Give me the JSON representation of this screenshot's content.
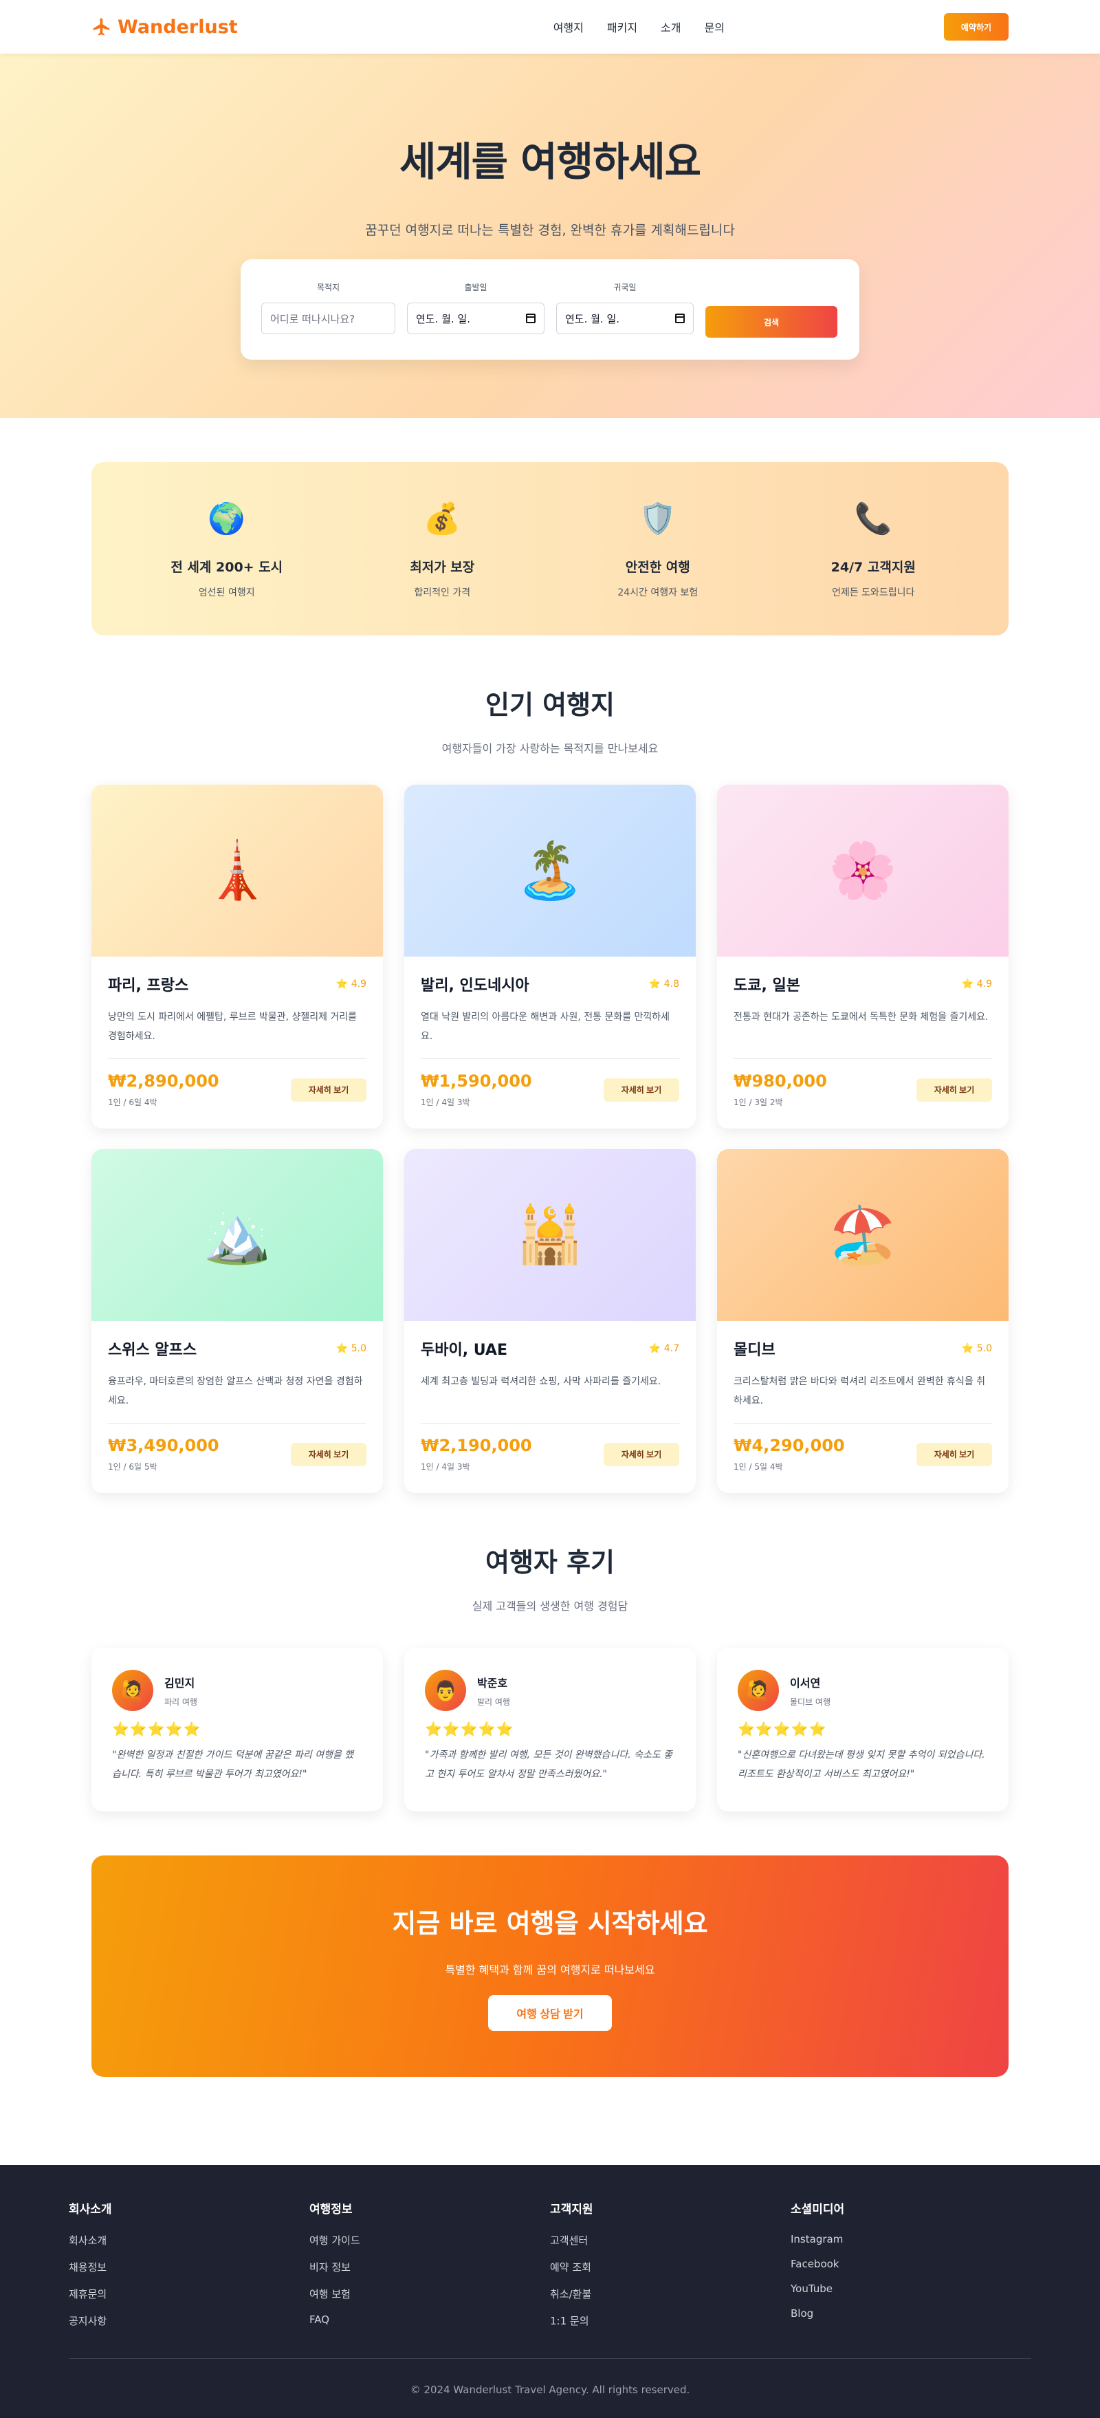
{
  "nav": {
    "logo": "Wanderlust",
    "menu": [
      "여행지",
      "패키지",
      "소개",
      "문의"
    ],
    "book_button": "예약하기"
  },
  "hero": {
    "title": "세계를 여행하세요",
    "subtitle": "꿈꾸던 여행지로 떠나는 특별한 경험, 완벽한 휴가를 계획해드립니다",
    "search": {
      "destination_label": "목적지",
      "destination_placeholder": "어디로 떠나시나요?",
      "departure_label": "출발일",
      "departure_value": "연도. 월. 일.",
      "return_label": "귀국일",
      "return_value": "연도. 월. 일.",
      "search_button": "검색"
    }
  },
  "features": [
    {
      "icon": "globe-icon",
      "glyph": "🌍",
      "title": "전 세계 200+ 도시",
      "desc": "엄선된 여행지"
    },
    {
      "icon": "money-bag-icon",
      "glyph": "💰",
      "title": "최저가 보장",
      "desc": "합리적인 가격"
    },
    {
      "icon": "shield-icon",
      "glyph": "🛡️",
      "title": "안전한 여행",
      "desc": "24시간 여행자 보험"
    },
    {
      "icon": "phone-icon",
      "glyph": "📞",
      "title": "24/7 고객지원",
      "desc": "언제든 도와드립니다"
    }
  ],
  "destinations_section": {
    "title": "인기 여행지",
    "subtitle": "여행자들이 가장 사랑하는 목적지를 만나보세요",
    "detail_label": "자세히 보기"
  },
  "destinations": [
    {
      "name": "파리, 프랑스",
      "rating": "⭐ 4.9",
      "desc": "낭만의 도시 파리에서 에펠탑, 루브르 박물관, 샹젤리제 거리를 경험하세요.",
      "price": "₩2,890,000",
      "duration": "1인 / 6일 4박",
      "glyph": "🗼",
      "icon": "tower-icon",
      "bg": "linear-gradient(135deg,#fef3c7,#fed7aa)"
    },
    {
      "name": "발리, 인도네시아",
      "rating": "⭐ 4.8",
      "desc": "열대 낙원 발리의 아름다운 해변과 사원, 전통 문화를 만끽하세요.",
      "price": "₩1,590,000",
      "duration": "1인 / 4일 3박",
      "glyph": "🏝️",
      "icon": "island-icon",
      "bg": "linear-gradient(135deg,#dbeafe,#bfdbfe)"
    },
    {
      "name": "도쿄, 일본",
      "rating": "⭐ 4.9",
      "desc": "전통과 현대가 공존하는 도쿄에서 독특한 문화 체험을 즐기세요.",
      "price": "₩980,000",
      "duration": "1인 / 3일 2박",
      "glyph": "🌸",
      "icon": "cherry-blossom-icon",
      "bg": "linear-gradient(135deg,#fce7f3,#fbcfe8)"
    },
    {
      "name": "스위스 알프스",
      "rating": "⭐ 5.0",
      "desc": "융프라우, 마터호른의 장엄한 알프스 산맥과 청정 자연을 경험하세요.",
      "price": "₩3,490,000",
      "duration": "1인 / 6일 5박",
      "glyph": "🏔️",
      "icon": "mountain-icon",
      "bg": "linear-gradient(135deg,#d1fae5,#a7f3d0)"
    },
    {
      "name": "두바이, UAE",
      "rating": "⭐ 4.7",
      "desc": "세계 최고층 빌딩과 럭셔리한 쇼핑, 사막 사파리를 즐기세요.",
      "price": "₩2,190,000",
      "duration": "1인 / 4일 3박",
      "glyph": "🕌",
      "icon": "mosque-icon",
      "bg": "linear-gradient(135deg,#ede9fe,#ddd6fe)"
    },
    {
      "name": "몰디브",
      "rating": "⭐ 5.0",
      "desc": "크리스탈처럼 맑은 바다와 럭셔리 리조트에서 완벽한 휴식을 취하세요.",
      "price": "₩4,290,000",
      "duration": "1인 / 5일 4박",
      "glyph": "🏖️",
      "icon": "beach-icon",
      "bg": "linear-gradient(135deg,#fed7aa,#fdba74)"
    }
  ],
  "reviews_section": {
    "title": "여행자 후기",
    "subtitle": "실제 고객들의 생생한 여행 경험담"
  },
  "reviews": [
    {
      "name": "김민지",
      "trip": "파리 여행",
      "stars": "⭐⭐⭐⭐⭐",
      "text": "\"완벽한 일정과 친절한 가이드 덕분에 꿈같은 파리 여행을 했습니다. 특히 루브르 박물관 투어가 최고였어요!\"",
      "avatar": "🙋",
      "avatar_icon": "person-icon"
    },
    {
      "name": "박준호",
      "trip": "발리 여행",
      "stars": "⭐⭐⭐⭐⭐",
      "text": "\"가족과 함께한 발리 여행, 모든 것이 완벽했습니다. 숙소도 좋고 현지 투어도 알차서 정말 만족스러웠어요.\"",
      "avatar": "👨",
      "avatar_icon": "person-icon"
    },
    {
      "name": "이서연",
      "trip": "몰디브 여행",
      "stars": "⭐⭐⭐⭐⭐",
      "text": "\"신혼여행으로 다녀왔는데 평생 잊지 못할 추억이 되었습니다. 리조트도 환상적이고 서비스도 최고였어요!\"",
      "avatar": "🙋",
      "avatar_icon": "person-icon"
    }
  ],
  "cta": {
    "title": "지금 바로 여행을 시작하세요",
    "subtitle": "특별한 혜택과 함께 꿈의 여행지로 떠나보세요",
    "button": "여행 상담 받기"
  },
  "footer": {
    "columns": [
      {
        "title": "회사소개",
        "links": [
          "회사소개",
          "채용정보",
          "제휴문의",
          "공지사항"
        ]
      },
      {
        "title": "여행정보",
        "links": [
          "여행 가이드",
          "비자 정보",
          "여행 보험",
          "FAQ"
        ]
      },
      {
        "title": "고객지원",
        "links": [
          "고객센터",
          "예약 조회",
          "취소/환불",
          "1:1 문의"
        ]
      },
      {
        "title": "소셜미디어",
        "links": [
          "Instagram",
          "Facebook",
          "YouTube",
          "Blog"
        ]
      }
    ],
    "copyright": "© 2024 Wanderlust Travel Agency. All rights reserved."
  }
}
